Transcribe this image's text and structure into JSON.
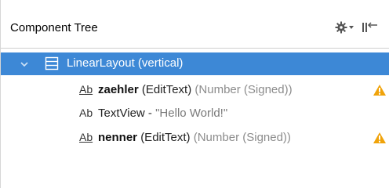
{
  "panel": {
    "title": "Component Tree",
    "toolbar": {
      "settings_icon": "gear-icon",
      "collapse_icon": "collapse-all-icon"
    }
  },
  "tree": {
    "root": {
      "label": "LinearLayout (vertical)",
      "expanded": true,
      "selected": true,
      "icon": "linear-layout-icon"
    },
    "children": [
      {
        "icon_text": "Ab",
        "id": "zaehler",
        "type": "(EditText)",
        "hint": "(Number (Signed))",
        "warning": true
      },
      {
        "icon_text": "Ab",
        "type": "TextView",
        "separator": " - ",
        "text": "\"Hello World!\"",
        "warning": false
      },
      {
        "icon_text": "Ab",
        "id": "nenner",
        "type": "(EditText)",
        "hint": "(Number (Signed))",
        "warning": true
      }
    ]
  },
  "colors": {
    "selection": "#3d88d6",
    "warning": "#f0a30a",
    "hint": "#8c8c8c"
  }
}
